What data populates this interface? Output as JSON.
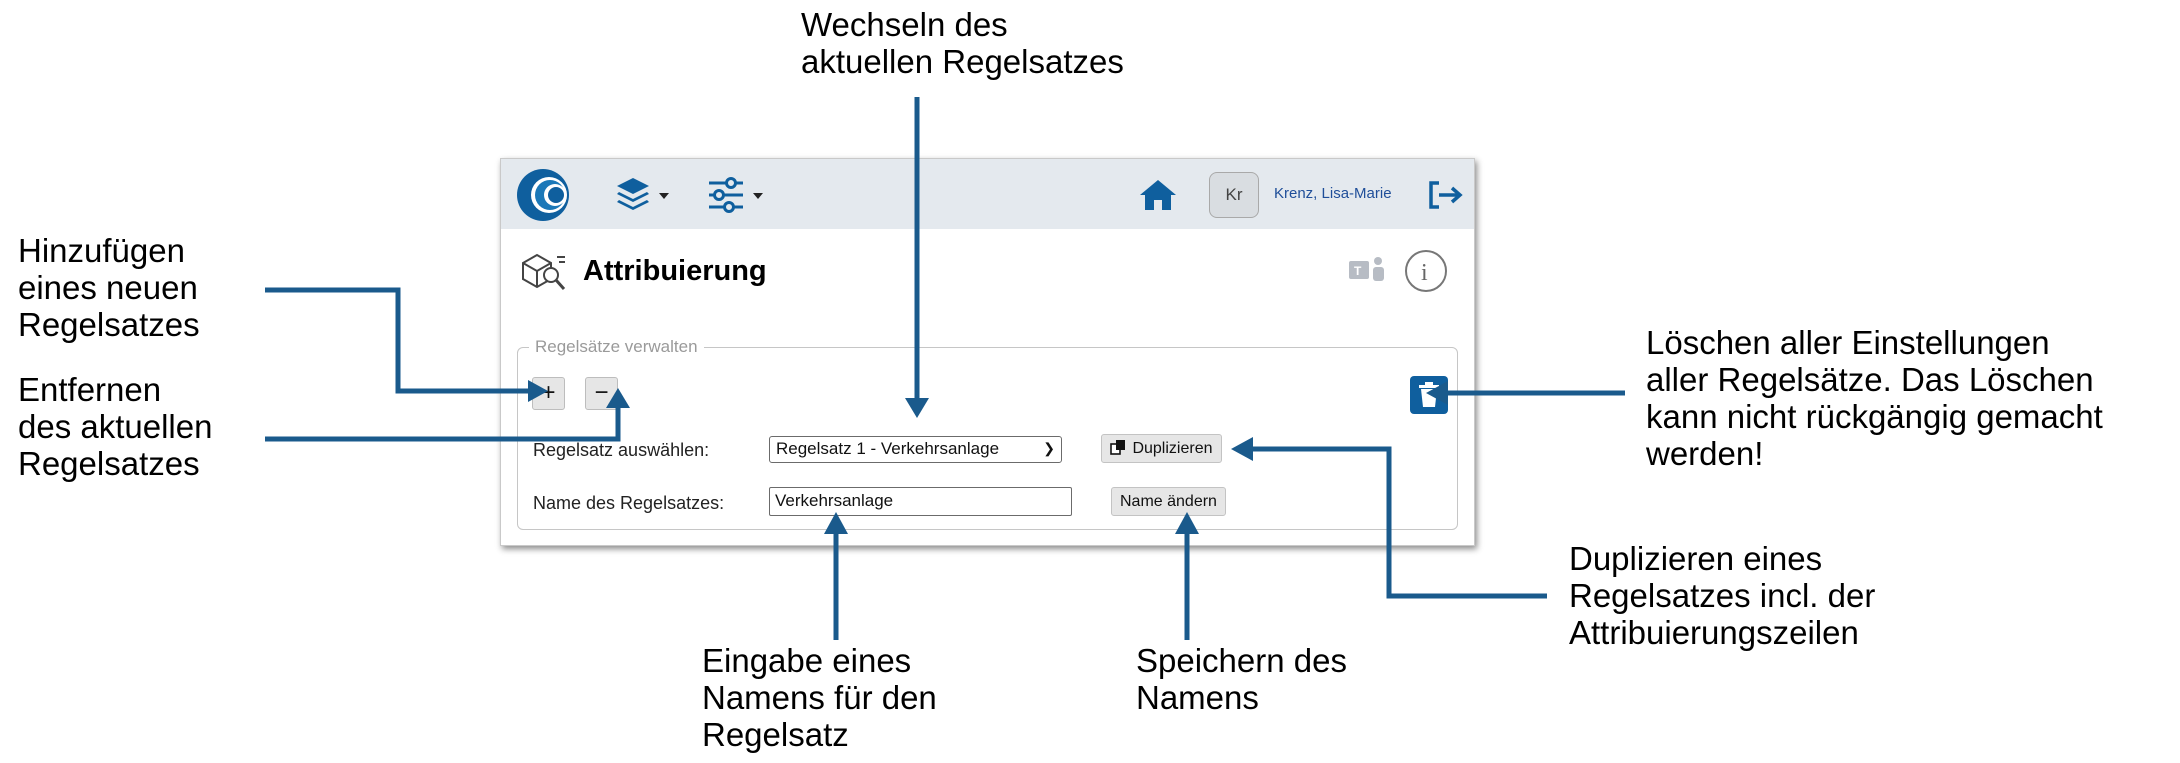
{
  "callouts": {
    "switch_ruleset": "Wechseln des\naktuellen Regelsatzes",
    "add_ruleset": "Hinzufügen\neines neuen\nRegelsatzes",
    "remove_ruleset": "Entfernen\ndes aktuellen\nRegelsatzes",
    "delete_all": "Löschen aller Einstellungen\naller Regelsätze. Das Löschen\nkann nicht rückgängig gemacht\nwerden!",
    "duplicate": "Duplizieren eines\nRegelsatzes incl. der\nAttribuierungszeilen",
    "enter_name": "Eingabe eines\nNamens für den\nRegelsatz",
    "save_name": "Speichern des\nNamens"
  },
  "topbar": {
    "avatar_initials": "Kr",
    "user_name": "Krenz, Lisa-Marie",
    "icons": [
      "app-logo-icon",
      "layers-icon",
      "sliders-icon",
      "home-icon",
      "logout-icon"
    ]
  },
  "page": {
    "title": "Attribuierung",
    "icons": [
      "attribution-icon",
      "teams-icon",
      "info-icon"
    ]
  },
  "manage": {
    "legend": "Regelsätze verwalten",
    "add_label": "+",
    "remove_label": "−",
    "select_label": "Regelsatz auswählen:",
    "select_value": "Regelsatz 1 - Verkehrsanlage",
    "duplicate_label": "Duplizieren",
    "name_label": "Name des Regelsatzes:",
    "name_value": "Verkehrsanlage",
    "rename_label": "Name ändern"
  },
  "colors": {
    "accent": "#0f5f9e",
    "arrow": "#1a5a8c",
    "topbar": "#e4e9ee",
    "user_text": "#1f4e99"
  }
}
